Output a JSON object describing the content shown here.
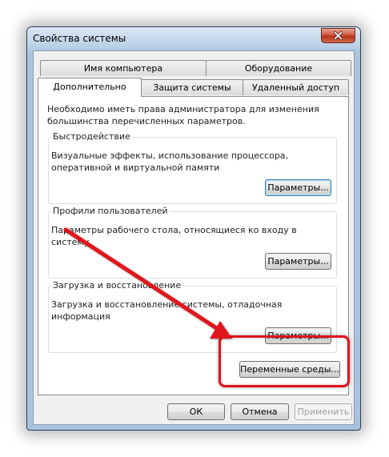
{
  "window": {
    "title": "Свойства системы"
  },
  "tabs": {
    "row1": [
      "Имя компьютера",
      "Оборудование"
    ],
    "row2": [
      "Дополнительно",
      "Защита системы",
      "Удаленный доступ"
    ],
    "active": "Дополнительно"
  },
  "panel": {
    "admin_note": "Необходимо иметь права администратора для изменения большинства перечисленных параметров.",
    "performance": {
      "title": "Быстродействие",
      "description": "Визуальные эффекты, использование процессора, оперативной и виртуальной памяти",
      "button": "Параметры..."
    },
    "profiles": {
      "title": "Профили пользователей",
      "description": "Параметры рабочего стола, относящиеся ко входу в систему",
      "button": "Параметры..."
    },
    "startup": {
      "title": "Загрузка и восстановление",
      "description": "Загрузка и восстановление системы, отладочная информация",
      "button": "Параметры..."
    },
    "env_button": "Переменные среды..."
  },
  "footer": {
    "ok": "ОК",
    "cancel": "Отмена",
    "apply": "Применить"
  },
  "colors": {
    "annotation": "#e0131b"
  },
  "icons": {
    "close": "close-icon"
  }
}
